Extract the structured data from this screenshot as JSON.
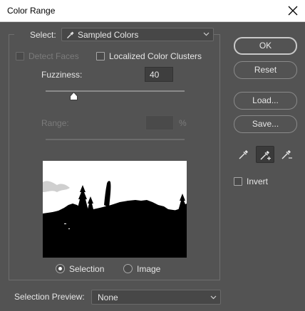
{
  "window": {
    "title": "Color Range"
  },
  "select": {
    "label": "Select:",
    "value": "Sampled Colors"
  },
  "detect_faces": {
    "label": "Detect Faces",
    "checked": false,
    "enabled": false
  },
  "localized_clusters": {
    "label": "Localized Color Clusters",
    "checked": false
  },
  "fuzziness": {
    "label": "Fuzziness:",
    "value": "40",
    "level": 0.2
  },
  "range": {
    "label": "Range:",
    "value": "",
    "unit": "%",
    "enabled": false
  },
  "preview_mode": {
    "options": [
      {
        "label": "Selection",
        "selected": true
      },
      {
        "label": "Image",
        "selected": false
      }
    ]
  },
  "selection_preview": {
    "label": "Selection Preview:",
    "value": "None"
  },
  "buttons": {
    "ok": "OK",
    "reset": "Reset",
    "load": "Load...",
    "save": "Save..."
  },
  "tools": [
    "eyedropper-icon",
    "eyedropper-plus-icon",
    "eyedropper-minus-icon"
  ],
  "invert": {
    "label": "Invert",
    "checked": false
  },
  "colors": {
    "background": "#535353",
    "titlebar": "#ffffff",
    "preview_fg": "#ffffff",
    "preview_bg": "#000000"
  }
}
